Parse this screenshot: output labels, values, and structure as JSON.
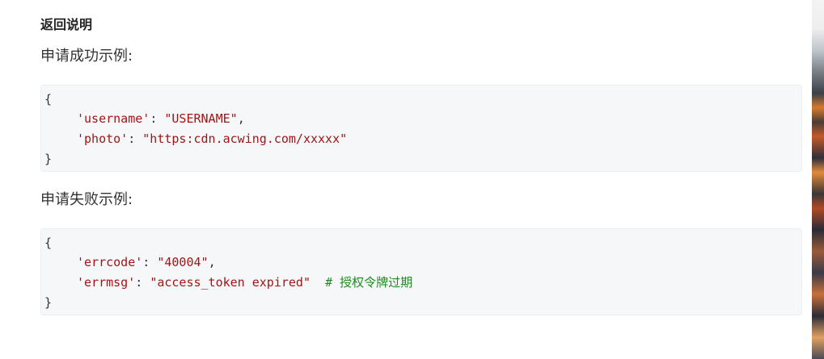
{
  "section": {
    "title": "返回说明"
  },
  "success": {
    "label": "申请成功示例:",
    "lines": {
      "open": "{",
      "key1": "'username'",
      "sep1": ": ",
      "val1": "\"USERNAME\"",
      "end1": ",",
      "key2": "'photo'",
      "sep2": ": ",
      "val2": "\"https:cdn.acwing.com/xxxxx\"",
      "close": "}"
    }
  },
  "failure": {
    "label": "申请失败示例:",
    "lines": {
      "open": "{",
      "key1": "'errcode'",
      "sep1": ": ",
      "val1": "\"40004\"",
      "end1": ",",
      "key2": "'errmsg'",
      "sep2": ": ",
      "val2": "\"access_token expired\"",
      "comment": "# 授权令牌过期",
      "close": "}"
    }
  },
  "colors": {
    "string": "#a31515",
    "comment": "#1f8a1f",
    "code_background": "#f6f7f9"
  }
}
